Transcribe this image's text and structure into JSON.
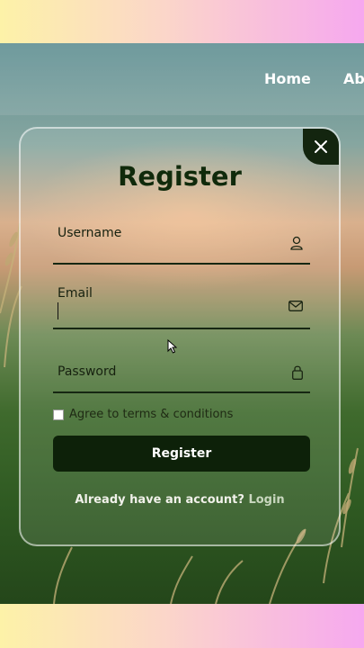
{
  "nav": {
    "items": [
      "Home",
      "Abo"
    ]
  },
  "form": {
    "title": "Register",
    "username_label": "Username",
    "email_label": "Email",
    "password_label": "Password",
    "terms_label": "Agree to terms & conditions",
    "submit_label": "Register",
    "account_prompt": "Already have an account?",
    "login_link": "Login"
  },
  "icons": {
    "close": "close-icon",
    "username": "user-icon",
    "email": "mail-icon",
    "password": "lock-icon"
  },
  "colors": {
    "accent_dark": "#0d2109",
    "title": "#102a0b"
  }
}
